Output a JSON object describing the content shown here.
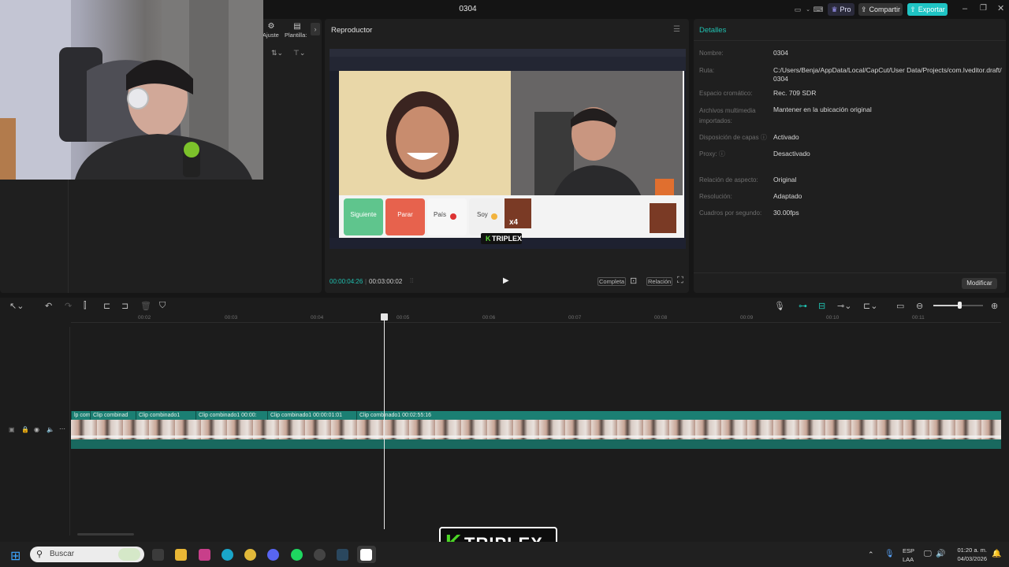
{
  "window": {
    "title": "0304",
    "pro_label": "Pro",
    "share_label": "Compartir",
    "export_label": "Exportar"
  },
  "left_panel": {
    "tab_adjust": "Ajuste",
    "tab_templates": "Plantilla:"
  },
  "player": {
    "title": "Reproductor",
    "current_time": "00:00:04:26",
    "total_time": "00:03:00:02",
    "btn_full": "Completa",
    "btn_ratio": "Relación",
    "preview": {
      "buttons": [
        "Siguiente",
        "Parar",
        "País",
        "Soy"
      ],
      "badge": "x4",
      "watermark": "TRIPLEX",
      "brand_k": "K"
    }
  },
  "details": {
    "title": "Detalles",
    "rows": [
      {
        "label": "Nombre:",
        "value": "0304"
      },
      {
        "label": "Ruta:",
        "value": "C:/Users/Benja/AppData/Local/CapCut/User Data/Projects/com.lveditor.draft/ 0304"
      },
      {
        "label": "Espacio cromático:",
        "value": "Rec. 709 SDR"
      },
      {
        "label": "Archivos multimedia importados:",
        "value": "Mantener en la ubicación original"
      },
      {
        "label": "Disposición de capas",
        "value": "Activado"
      },
      {
        "label": "Proxy:",
        "value": "Desactivado"
      },
      {
        "label": "Relación de aspecto:",
        "value": "Original"
      },
      {
        "label": "Resolución:",
        "value": "Adaptado"
      },
      {
        "label": "Cuadros por segundo:",
        "value": "30.00fps"
      }
    ],
    "modify_label": "Modificar"
  },
  "timeline": {
    "ticks": [
      "00:02",
      "00:03",
      "00:04",
      "00:05",
      "00:06",
      "00:07",
      "00:08",
      "00:09",
      "00:10",
      "00:11"
    ],
    "clips": [
      "lp comi",
      "Clip combinad",
      "Clip combinado1",
      "Clip combinado1  00:00:",
      "Clip combinado1  00:00:01:01",
      "Clip combinado1  00:02:55:16"
    ]
  },
  "watermark_bottom": {
    "k": "K",
    "text": "TRIPLEX"
  },
  "taskbar": {
    "search_placeholder": "Buscar",
    "lang": "ESP",
    "layout": "LAA",
    "time": "01:20 a. m.",
    "date": "04/03/2026"
  },
  "colors": {
    "accent": "#20c0b0",
    "clip": "#1b7f73",
    "export": "#1fc4c4"
  }
}
